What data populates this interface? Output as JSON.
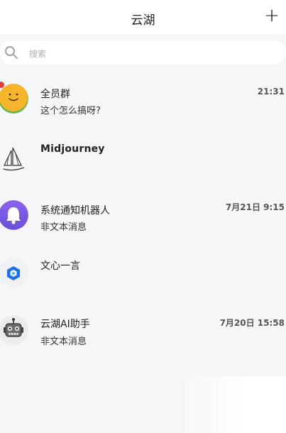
{
  "header": {
    "title": "云湖",
    "add_label": "+"
  },
  "search": {
    "placeholder": "搜索"
  },
  "chats": [
    {
      "name": "全员群",
      "preview": "这个怎么搞呀?",
      "time": "21:31",
      "avatar": "smiley-icon",
      "unread": true
    },
    {
      "name": "Midjourney",
      "preview": "",
      "time": "",
      "avatar": "sailboat-icon"
    },
    {
      "name": "系统通知机器人",
      "preview": "非文本消息",
      "time": "7月21日 9:15",
      "avatar": "bell-icon"
    },
    {
      "name": "文心一言",
      "preview": "",
      "time": "",
      "avatar": "wenxin-logo-icon"
    },
    {
      "name": "云湖AI助手",
      "preview": "非文本消息",
      "time": "7月20日 15:58",
      "avatar": "robot-icon"
    }
  ],
  "colors": {
    "bell_gradient_top": "#8a63f0",
    "bell_gradient_bottom": "#6b4fd8",
    "unread": "#e23c3c",
    "wenxin_blue": "#1d6ff2"
  }
}
